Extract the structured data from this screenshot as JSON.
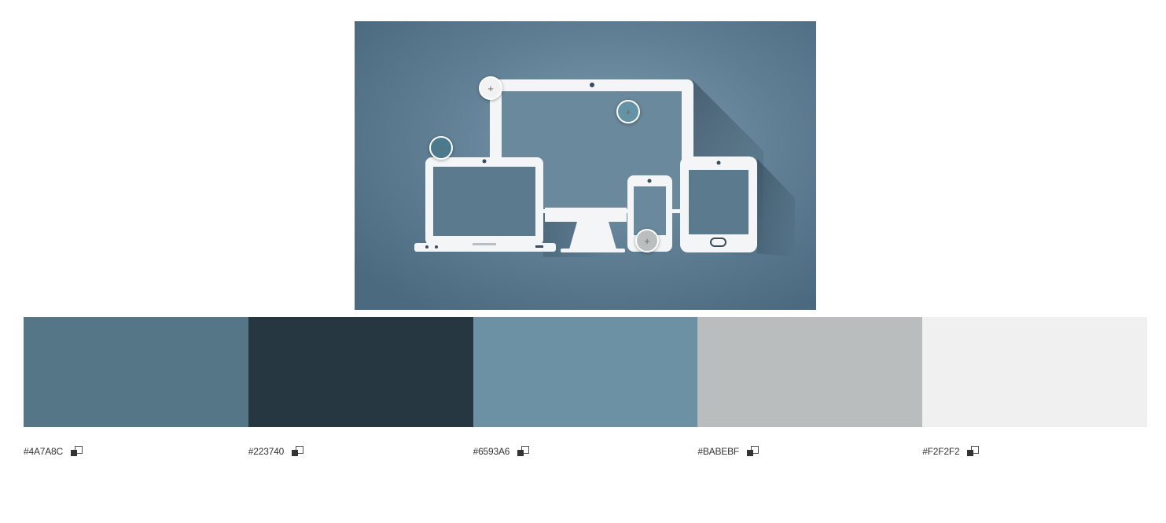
{
  "image": {
    "subject": "responsive-devices-illustration",
    "pickers": [
      {
        "id": "picker-1",
        "glyph": "+",
        "sampled_color": "#F2F2F2"
      },
      {
        "id": "picker-2",
        "glyph": "+",
        "sampled_color": "#6593A6"
      },
      {
        "id": "picker-3",
        "glyph": "+",
        "sampled_color": "#4A7A8C"
      },
      {
        "id": "picker-4",
        "glyph": "+",
        "sampled_color": "#BABEBF"
      }
    ]
  },
  "palette": {
    "swatches": [
      {
        "hex": "#4A7A8C",
        "display_color": "#547686"
      },
      {
        "hex": "#223740",
        "display_color": "#263742"
      },
      {
        "hex": "#6593A6",
        "display_color": "#6d91a4"
      },
      {
        "hex": "#BABEBF",
        "display_color": "#b9bdbe"
      },
      {
        "hex": "#F2F2F2",
        "display_color": "#f0f0f0"
      }
    ],
    "copy_icon": "copy-icon"
  }
}
